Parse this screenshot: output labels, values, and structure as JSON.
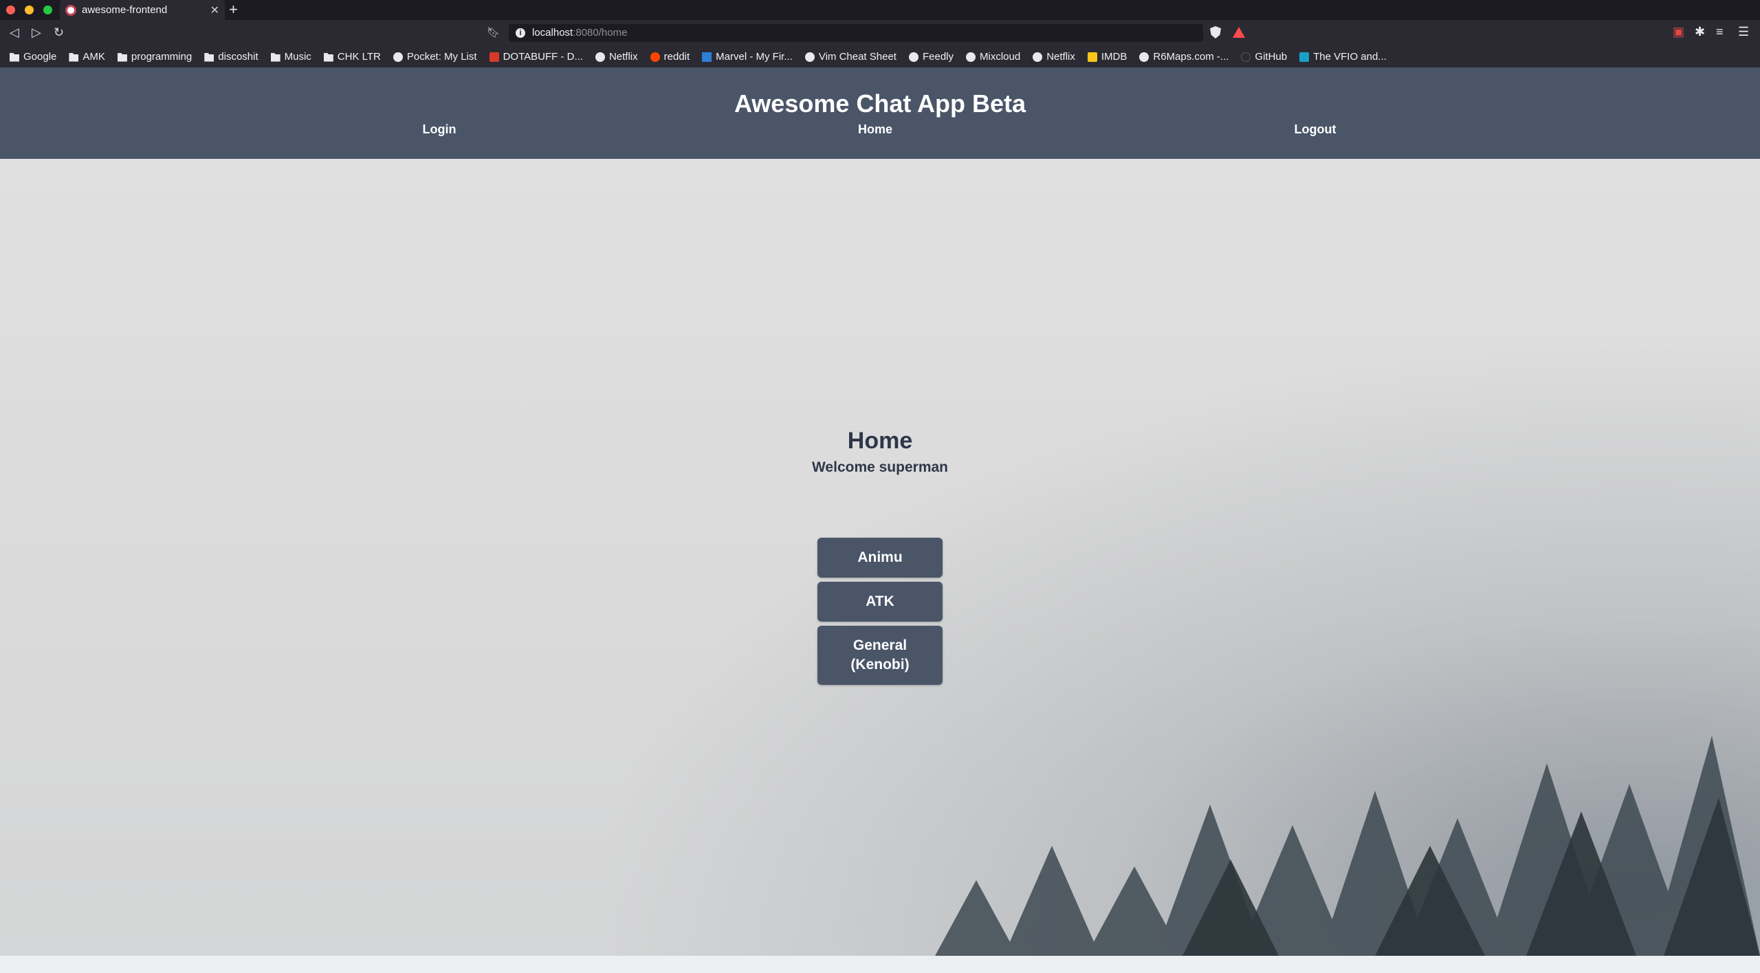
{
  "browser": {
    "tab_title": "awesome-frontend",
    "url_host": "localhost",
    "url_path": ":8080/home",
    "bookmarks": [
      {
        "label": "Google",
        "icon": "folder-icon"
      },
      {
        "label": "AMK",
        "icon": "folder-icon"
      },
      {
        "label": "programming",
        "icon": "folder-icon"
      },
      {
        "label": "discoshit",
        "icon": "folder-icon"
      },
      {
        "label": "Music",
        "icon": "folder-icon"
      },
      {
        "label": "CHK LTR",
        "icon": "folder-icon"
      },
      {
        "label": "Pocket: My List",
        "icon": "globe-icon"
      },
      {
        "label": "DOTABUFF - D...",
        "icon": "dotabuff-icon"
      },
      {
        "label": "Netflix",
        "icon": "globe-icon"
      },
      {
        "label": "reddit",
        "icon": "reddit-icon"
      },
      {
        "label": "Marvel - My Fir...",
        "icon": "marvel-icon"
      },
      {
        "label": "Vim Cheat Sheet",
        "icon": "globe-icon"
      },
      {
        "label": "Feedly",
        "icon": "globe-icon"
      },
      {
        "label": "Mixcloud",
        "icon": "globe-icon"
      },
      {
        "label": "Netflix",
        "icon": "globe-icon"
      },
      {
        "label": "IMDB",
        "icon": "imdb-icon"
      },
      {
        "label": "R6Maps.com -...",
        "icon": "globe-icon"
      },
      {
        "label": "GitHub",
        "icon": "github-icon"
      },
      {
        "label": "The VFIO and...",
        "icon": "vfio-icon"
      }
    ]
  },
  "app": {
    "title": "Awesome Chat App Beta",
    "nav": {
      "login": "Login",
      "home": "Home",
      "logout": "Logout"
    }
  },
  "home": {
    "title": "Home",
    "welcome": "Welcome superman",
    "rooms": [
      "Animu",
      "ATK",
      "General (Kenobi)"
    ]
  },
  "colors": {
    "header_bg": "#4a5568",
    "button_bg": "#4a5568",
    "heading_text": "#2d3748"
  }
}
